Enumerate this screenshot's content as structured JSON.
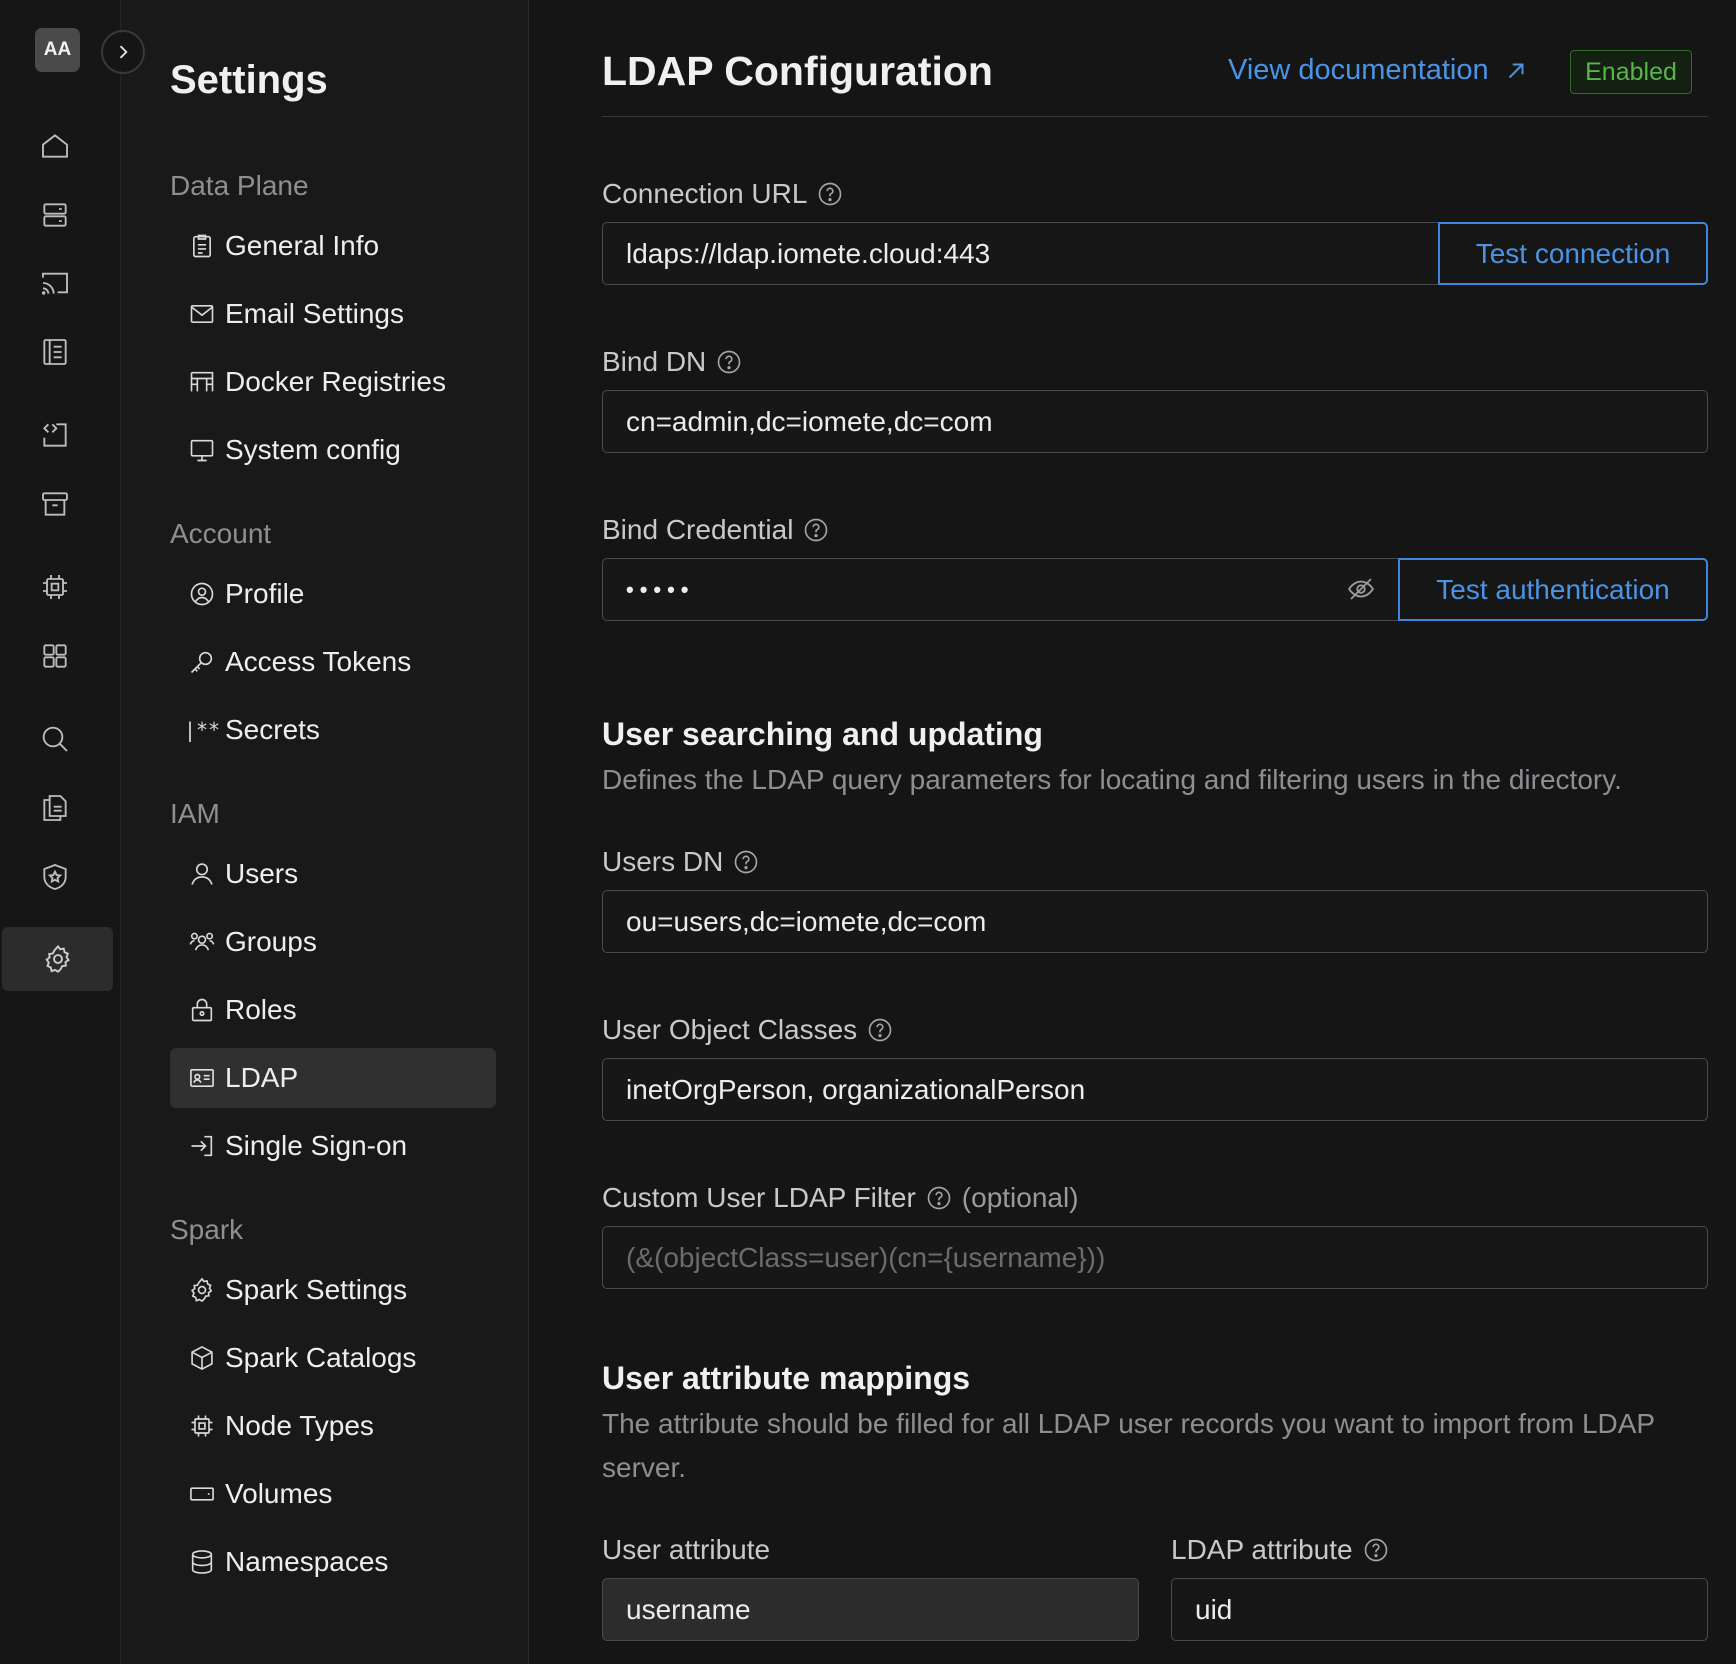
{
  "user": {
    "initials": "AA"
  },
  "rail": {
    "icons": [
      "home-icon",
      "server-icon",
      "cast-icon",
      "notebook-icon",
      "code-file-icon",
      "archive-icon",
      "chip-icon",
      "grid-icon",
      "search-icon",
      "files-icon",
      "shield-star-icon",
      "gear-icon"
    ],
    "active": "gear-icon"
  },
  "menu": {
    "title": "Settings",
    "groups": [
      {
        "label": "Data Plane",
        "items": [
          {
            "label": "General Info",
            "icon": "clipboard-icon"
          },
          {
            "label": "Email Settings",
            "icon": "mail-icon"
          },
          {
            "label": "Docker Registries",
            "icon": "registry-icon"
          },
          {
            "label": "System config",
            "icon": "monitor-icon"
          }
        ]
      },
      {
        "label": "Account",
        "items": [
          {
            "label": "Profile",
            "icon": "profile-icon"
          },
          {
            "label": "Access Tokens",
            "icon": "key-icon"
          },
          {
            "label": "Secrets",
            "icon": "secret-icon"
          }
        ]
      },
      {
        "label": "IAM",
        "items": [
          {
            "label": "Users",
            "icon": "user-icon"
          },
          {
            "label": "Groups",
            "icon": "group-icon"
          },
          {
            "label": "Roles",
            "icon": "lock-icon"
          },
          {
            "label": "LDAP",
            "icon": "id-card-icon",
            "active": true
          },
          {
            "label": "Single Sign-on",
            "icon": "sign-in-icon"
          }
        ]
      },
      {
        "label": "Spark",
        "items": [
          {
            "label": "Spark Settings",
            "icon": "gear-icon"
          },
          {
            "label": "Spark Catalogs",
            "icon": "cube-icon"
          },
          {
            "label": "Node Types",
            "icon": "chip-icon"
          },
          {
            "label": "Volumes",
            "icon": "drive-icon"
          },
          {
            "label": "Namespaces",
            "icon": "database-icon"
          }
        ]
      }
    ]
  },
  "page": {
    "title": "LDAP Configuration",
    "doc_link": "View documentation",
    "status": "Enabled"
  },
  "form": {
    "connection_url": {
      "label": "Connection URL",
      "value": "ldaps://ldap.iomete.cloud:443",
      "button": "Test connection"
    },
    "bind_dn": {
      "label": "Bind DN",
      "value": "cn=admin,dc=iomete,dc=com"
    },
    "bind_credential": {
      "label": "Bind Credential",
      "masked_value": "•••••",
      "button": "Test authentication"
    },
    "user_search": {
      "title": "User searching and updating",
      "description": "Defines the LDAP query parameters for locating and filtering users in the directory."
    },
    "users_dn": {
      "label": "Users DN",
      "value": "ou=users,dc=iomete,dc=com"
    },
    "user_object_classes": {
      "label": "User Object Classes",
      "value": "inetOrgPerson, organizationalPerson"
    },
    "custom_filter": {
      "label": "Custom User LDAP Filter",
      "optional": "(optional)",
      "placeholder": "(&(objectClass=user)(cn={username}))"
    },
    "attribute_mappings": {
      "title": "User attribute mappings",
      "description": "The attribute should be filled for all LDAP user records you want to import from LDAP server.",
      "user_attribute_label": "User attribute",
      "ldap_attribute_label": "LDAP attribute",
      "user_attribute_value": "username",
      "ldap_attribute_value": "uid"
    }
  },
  "colors": {
    "accent": "#4a94e6",
    "enabled": "#57b54a",
    "background": "#151515"
  }
}
